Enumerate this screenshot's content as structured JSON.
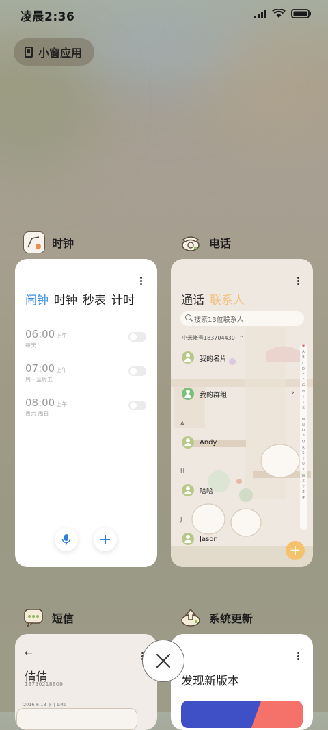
{
  "status_bar": {
    "time": "凌晨2:36"
  },
  "mini_window": {
    "label": "小窗应用"
  },
  "apps": {
    "clock": {
      "name": "时钟",
      "tabs": [
        "闹钟",
        "时钟",
        "秒表",
        "计时"
      ],
      "alarms": [
        {
          "time": "06:00",
          "ampm": "上午",
          "repeat": "每天"
        },
        {
          "time": "07:00",
          "ampm": "上午",
          "repeat": "周一至周五"
        },
        {
          "time": "08:00",
          "ampm": "上午",
          "repeat": "周六 周日"
        }
      ]
    },
    "phone": {
      "name": "电话",
      "tabs": [
        "通话",
        "联系人"
      ],
      "search_placeholder": "搜索13位联系人",
      "account": "小米帐号183704430",
      "contacts": [
        {
          "name": "我的名片"
        },
        {
          "name": "我的群组"
        },
        {
          "name": "Andy",
          "index": "A"
        },
        {
          "name": "哈哈",
          "index": "H"
        },
        {
          "name": "Jason",
          "index": "J"
        }
      ],
      "alphabet": [
        "♥",
        "A",
        "B",
        "C",
        "D",
        "E",
        "F",
        "G",
        "H",
        "I",
        "J",
        "K",
        "L",
        "M",
        "N",
        "O",
        "P",
        "Q",
        "R",
        "S",
        "T",
        "U",
        "V",
        "W",
        "X",
        "Y",
        "Z",
        "#"
      ]
    },
    "sms": {
      "name": "短信",
      "contact_name": "倩倩",
      "contact_number": "18730218809",
      "timestamp": "2016-6-13 下午1:49"
    },
    "update": {
      "name": "系统更新",
      "title": "发现新版本"
    }
  },
  "colors": {
    "clock_accent": "#3b8fe0",
    "phone_accent": "#f3c07b",
    "fab_orange": "#f5c26c"
  }
}
